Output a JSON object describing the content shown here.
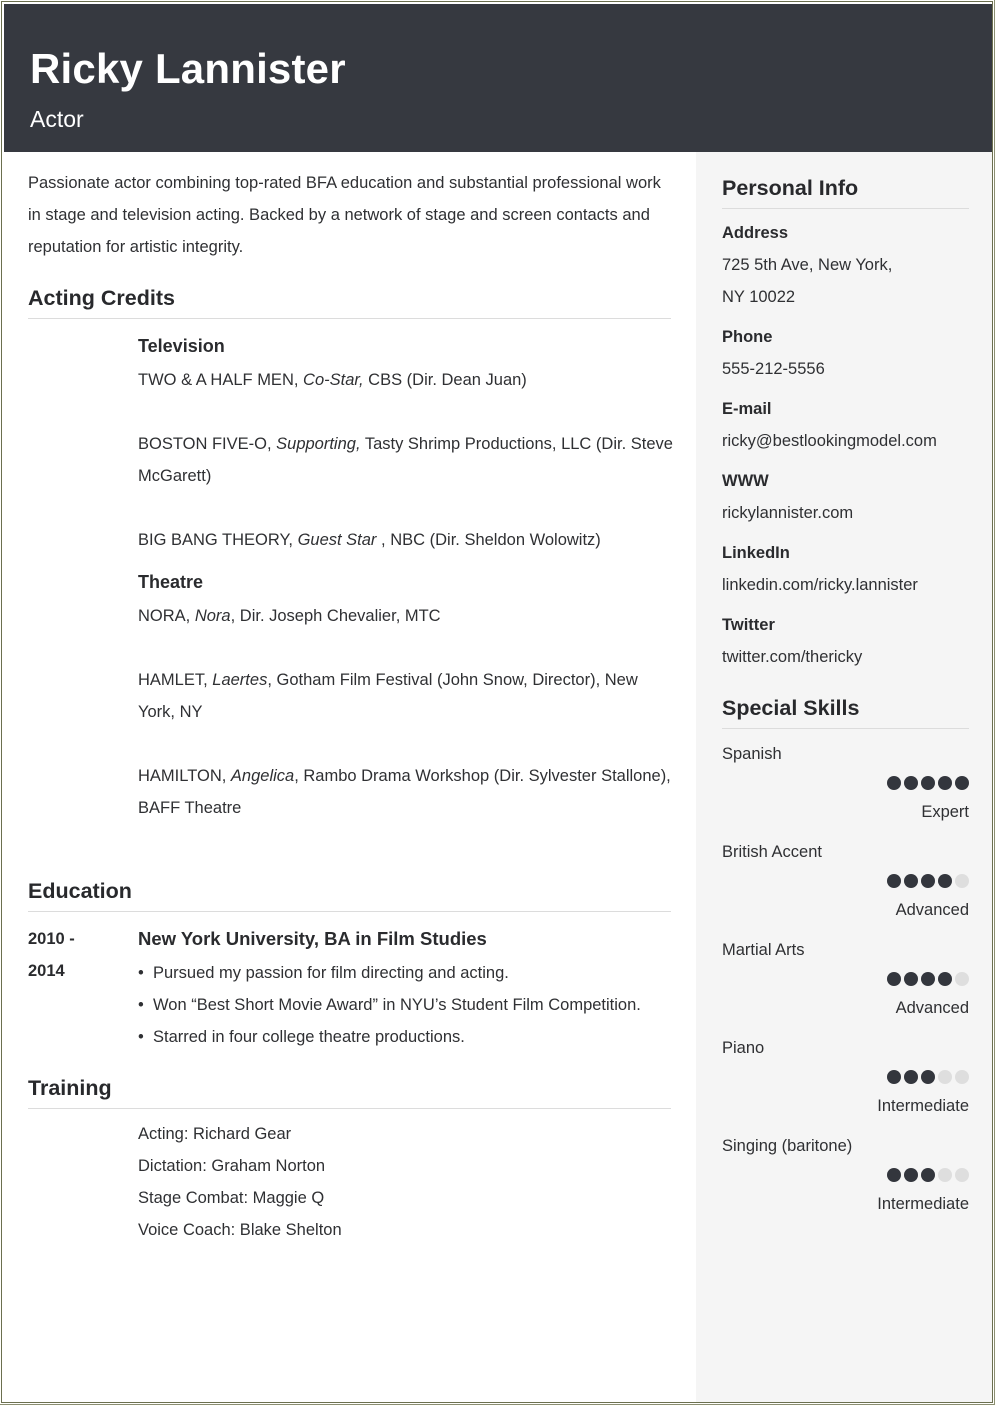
{
  "header": {
    "name": "Ricky Lannister",
    "title": "Actor"
  },
  "summary": "Passionate actor combining top-rated BFA education and substantial professional work in stage and television acting. Backed by a network of stage and screen contacts and reputation for artistic integrity.",
  "acting_credits": {
    "heading": "Acting Credits",
    "television": {
      "heading": "Television",
      "items": [
        {
          "show": "TWO & A HALF MEN, ",
          "role": "Co-Star,",
          "rest": " CBS (Dir. Dean Juan)"
        },
        {
          "show": "BOSTON FIVE-O, ",
          "role": "Supporting,",
          "rest": " Tasty Shrimp Productions, LLC (Dir. Steve McGarett)"
        },
        {
          "show": "BIG BANG THEORY, ",
          "role": "Guest Star",
          "rest": " , NBC (Dir. Sheldon Wolowitz)"
        }
      ]
    },
    "theatre": {
      "heading": "Theatre",
      "items": [
        {
          "show": "NORA, ",
          "role": "Nora",
          "rest": ", Dir. Joseph Chevalier, MTC"
        },
        {
          "show": "HAMLET, ",
          "role": "Laertes",
          "rest": ", Gotham Film Festival (John Snow, Director), New York, NY"
        },
        {
          "show": "HAMILTON, ",
          "role": "Angelica",
          "rest": ", Rambo Drama Workshop (Dir. Sylvester Stallone), BAFF  Theatre"
        }
      ]
    }
  },
  "education": {
    "heading": "Education",
    "date_start": "2010 -",
    "date_end": "2014",
    "school": "New York University, BA in Film Studies",
    "bullets": [
      "Pursued my passion for film directing and acting.",
      "Won “Best Short Movie Award” in NYU’s Student Film Competition.",
      "Starred in four college theatre productions."
    ]
  },
  "training": {
    "heading": "Training",
    "items": [
      "Acting: Richard Gear",
      "Dictation: Graham Norton",
      "Stage Combat: Maggie Q",
      "Voice Coach: Blake Shelton"
    ]
  },
  "personal_info": {
    "heading": "Personal Info",
    "fields": [
      {
        "label": "Address",
        "value": "725 5th Ave, New York, NY 10022"
      },
      {
        "label": "Phone",
        "value": "555-212-5556"
      },
      {
        "label": "E-mail",
        "value": "ricky@bestlookingmodel.com"
      },
      {
        "label": "WWW",
        "value": "rickylannister.com"
      },
      {
        "label": "LinkedIn",
        "value": "linkedin.com/ricky.lannister"
      },
      {
        "label": "Twitter",
        "value": "twitter.com/thericky"
      }
    ]
  },
  "special_skills": {
    "heading": "Special Skills",
    "max_rating": 5,
    "items": [
      {
        "name": "Spanish",
        "rating": 5,
        "level": "Expert"
      },
      {
        "name": "British Accent",
        "rating": 4,
        "level": "Advanced"
      },
      {
        "name": "Martial Arts",
        "rating": 4,
        "level": "Advanced"
      },
      {
        "name": "Piano",
        "rating": 3,
        "level": "Intermediate"
      },
      {
        "name": "Singing (baritone)",
        "rating": 3,
        "level": "Intermediate"
      }
    ]
  },
  "colors": {
    "header_bg": "#363940",
    "sidebar_bg": "#f5f5f5",
    "dot_filled": "#33363d",
    "dot_empty": "#dedede"
  }
}
